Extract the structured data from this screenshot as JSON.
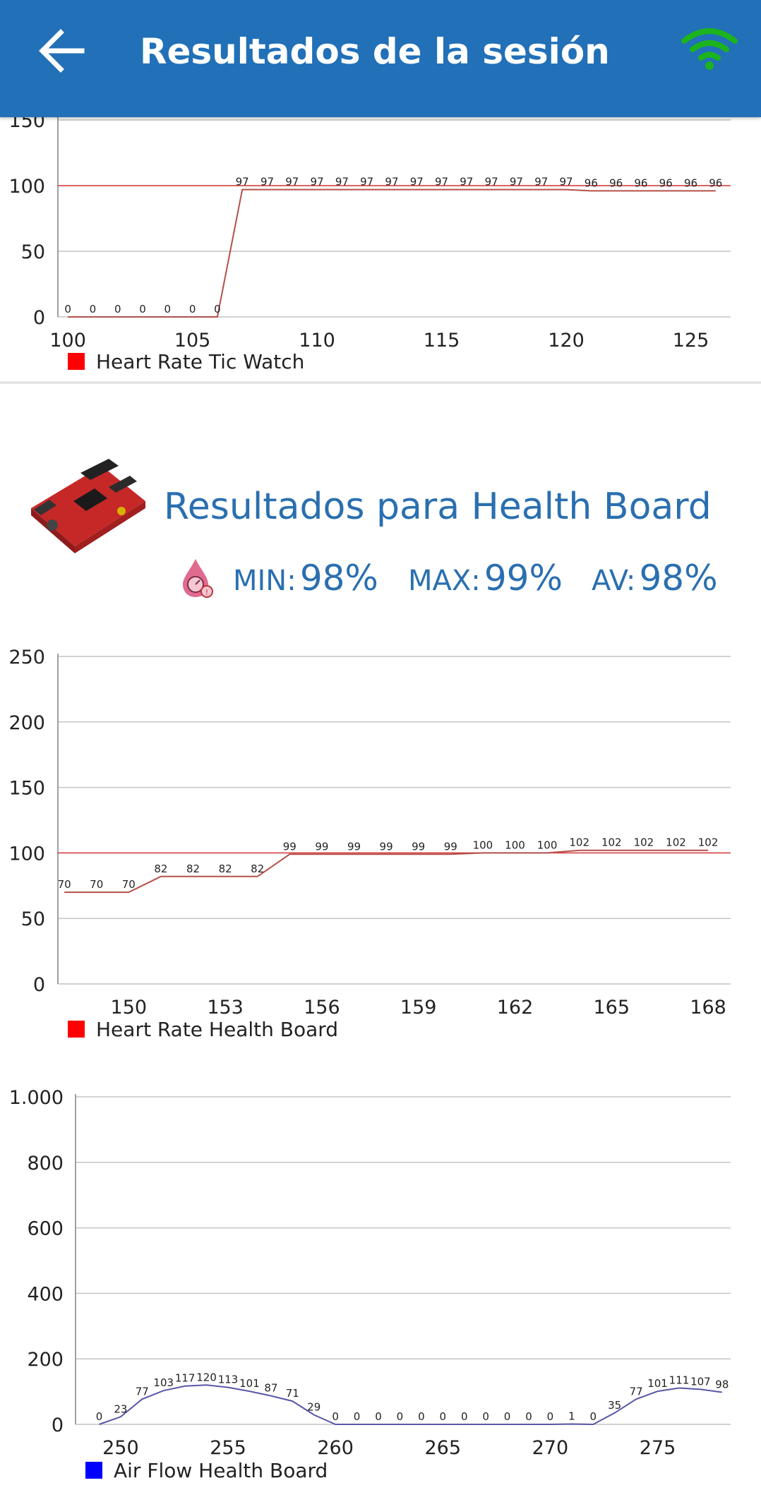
{
  "header": {
    "title": "Resultados de la sesión",
    "back_icon": "arrow-left-icon",
    "status_icon": "wifi-icon",
    "status_color": "#1db31d",
    "bar_color": "#2170b8"
  },
  "board": {
    "title": "Resultados para Health Board",
    "image_icon": "circuit-board-icon",
    "stat_icon": "blood-drop-gauge-icon",
    "min_label": "MIN:",
    "min_value": "98%",
    "max_label": "MAX:",
    "max_value": "99%",
    "av_label": "AV:",
    "av_value": "98%"
  },
  "chart_data": [
    {
      "type": "line",
      "legend": "Heart Rate Tic Watch",
      "color": "#ff0000",
      "line_color": "#b5504a",
      "ylim": [
        0,
        150
      ],
      "y_ticks": [
        "0",
        "50",
        "100",
        "150"
      ],
      "xlim": [
        99.6,
        126.6
      ],
      "x_ticks": [
        100,
        105,
        110,
        115,
        120,
        125
      ],
      "x": [
        100,
        101,
        102,
        103,
        104,
        105,
        106,
        107,
        108,
        109,
        110,
        111,
        112,
        113,
        114,
        115,
        116,
        117,
        118,
        119,
        120,
        121,
        122,
        123,
        124,
        125,
        126
      ],
      "values": [
        0,
        0,
        0,
        0,
        0,
        0,
        0,
        97,
        97,
        97,
        97,
        97,
        97,
        97,
        97,
        97,
        97,
        97,
        97,
        97,
        97,
        96,
        96,
        96,
        96,
        96,
        96
      ],
      "reference": 100
    },
    {
      "type": "line",
      "legend": "Heart Rate Health Board",
      "color": "#ff0000",
      "line_color": "#b5504a",
      "ylim": [
        0,
        250
      ],
      "y_ticks": [
        "0",
        "50",
        "100",
        "150",
        "200",
        "250"
      ],
      "xlim": [
        147.8,
        168.7
      ],
      "x_ticks": [
        150,
        153,
        156,
        159,
        162,
        165,
        168
      ],
      "x": [
        148,
        149,
        150,
        151,
        152,
        153,
        154,
        155,
        156,
        157,
        158,
        159,
        160,
        161,
        162,
        163,
        164,
        165,
        166,
        167,
        168
      ],
      "values": [
        70,
        70,
        70,
        82,
        82,
        82,
        82,
        99,
        99,
        99,
        99,
        99,
        99,
        100,
        100,
        100,
        102,
        102,
        102,
        102,
        102
      ],
      "reference": 100
    },
    {
      "type": "line",
      "legend": "Air Flow Health Board",
      "color": "#0000ff",
      "line_color": "#5757a6",
      "ylim": [
        0,
        1000
      ],
      "y_ticks": [
        "0",
        "200",
        "400",
        "600",
        "800",
        "1.000"
      ],
      "xlim": [
        247.9,
        278.4
      ],
      "x_ticks": [
        250,
        255,
        260,
        265,
        270,
        275
      ],
      "x": [
        249,
        250,
        251,
        252,
        253,
        254,
        255,
        256,
        257,
        258,
        259,
        260,
        261,
        262,
        263,
        264,
        265,
        266,
        267,
        268,
        269,
        270,
        271,
        272,
        273,
        274,
        275,
        276,
        277,
        278
      ],
      "values": [
        0,
        23,
        77,
        103,
        117,
        120,
        113,
        101,
        87,
        71,
        29,
        0,
        0,
        0,
        0,
        0,
        0,
        0,
        0,
        0,
        0,
        0,
        1,
        0,
        35,
        77,
        101,
        111,
        107,
        98
      ]
    }
  ]
}
